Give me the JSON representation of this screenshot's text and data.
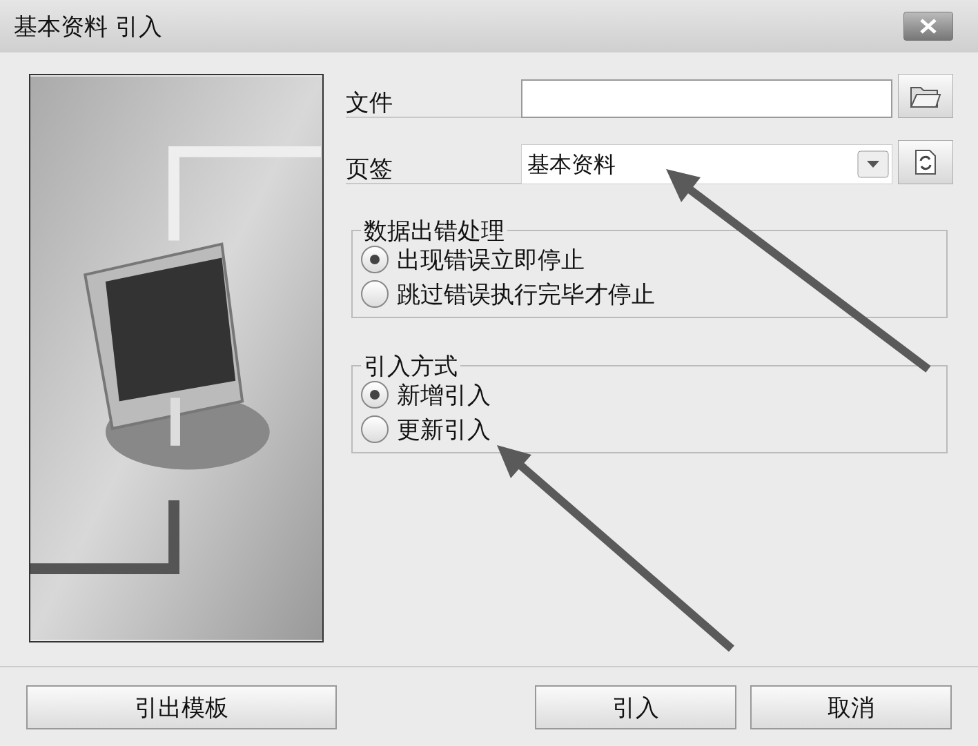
{
  "window": {
    "title": "基本资料 引入"
  },
  "fields": [
    {
      "label": "文件",
      "kind": "file"
    },
    {
      "label": "页签",
      "kind": "select",
      "value": "基本资料"
    }
  ],
  "groups": [
    {
      "title": "数据出错处理",
      "options": [
        {
          "label": "出现错误立即停止",
          "selected": true
        },
        {
          "label": "跳过错误执行完毕才停止",
          "selected": false
        }
      ]
    },
    {
      "title": "引入方式",
      "options": [
        {
          "label": "新增引入",
          "selected": true
        },
        {
          "label": "更新引入",
          "selected": false
        }
      ]
    }
  ],
  "footer": {
    "left_button": "引出模板",
    "right_buttons": [
      "引入",
      "取消"
    ]
  }
}
